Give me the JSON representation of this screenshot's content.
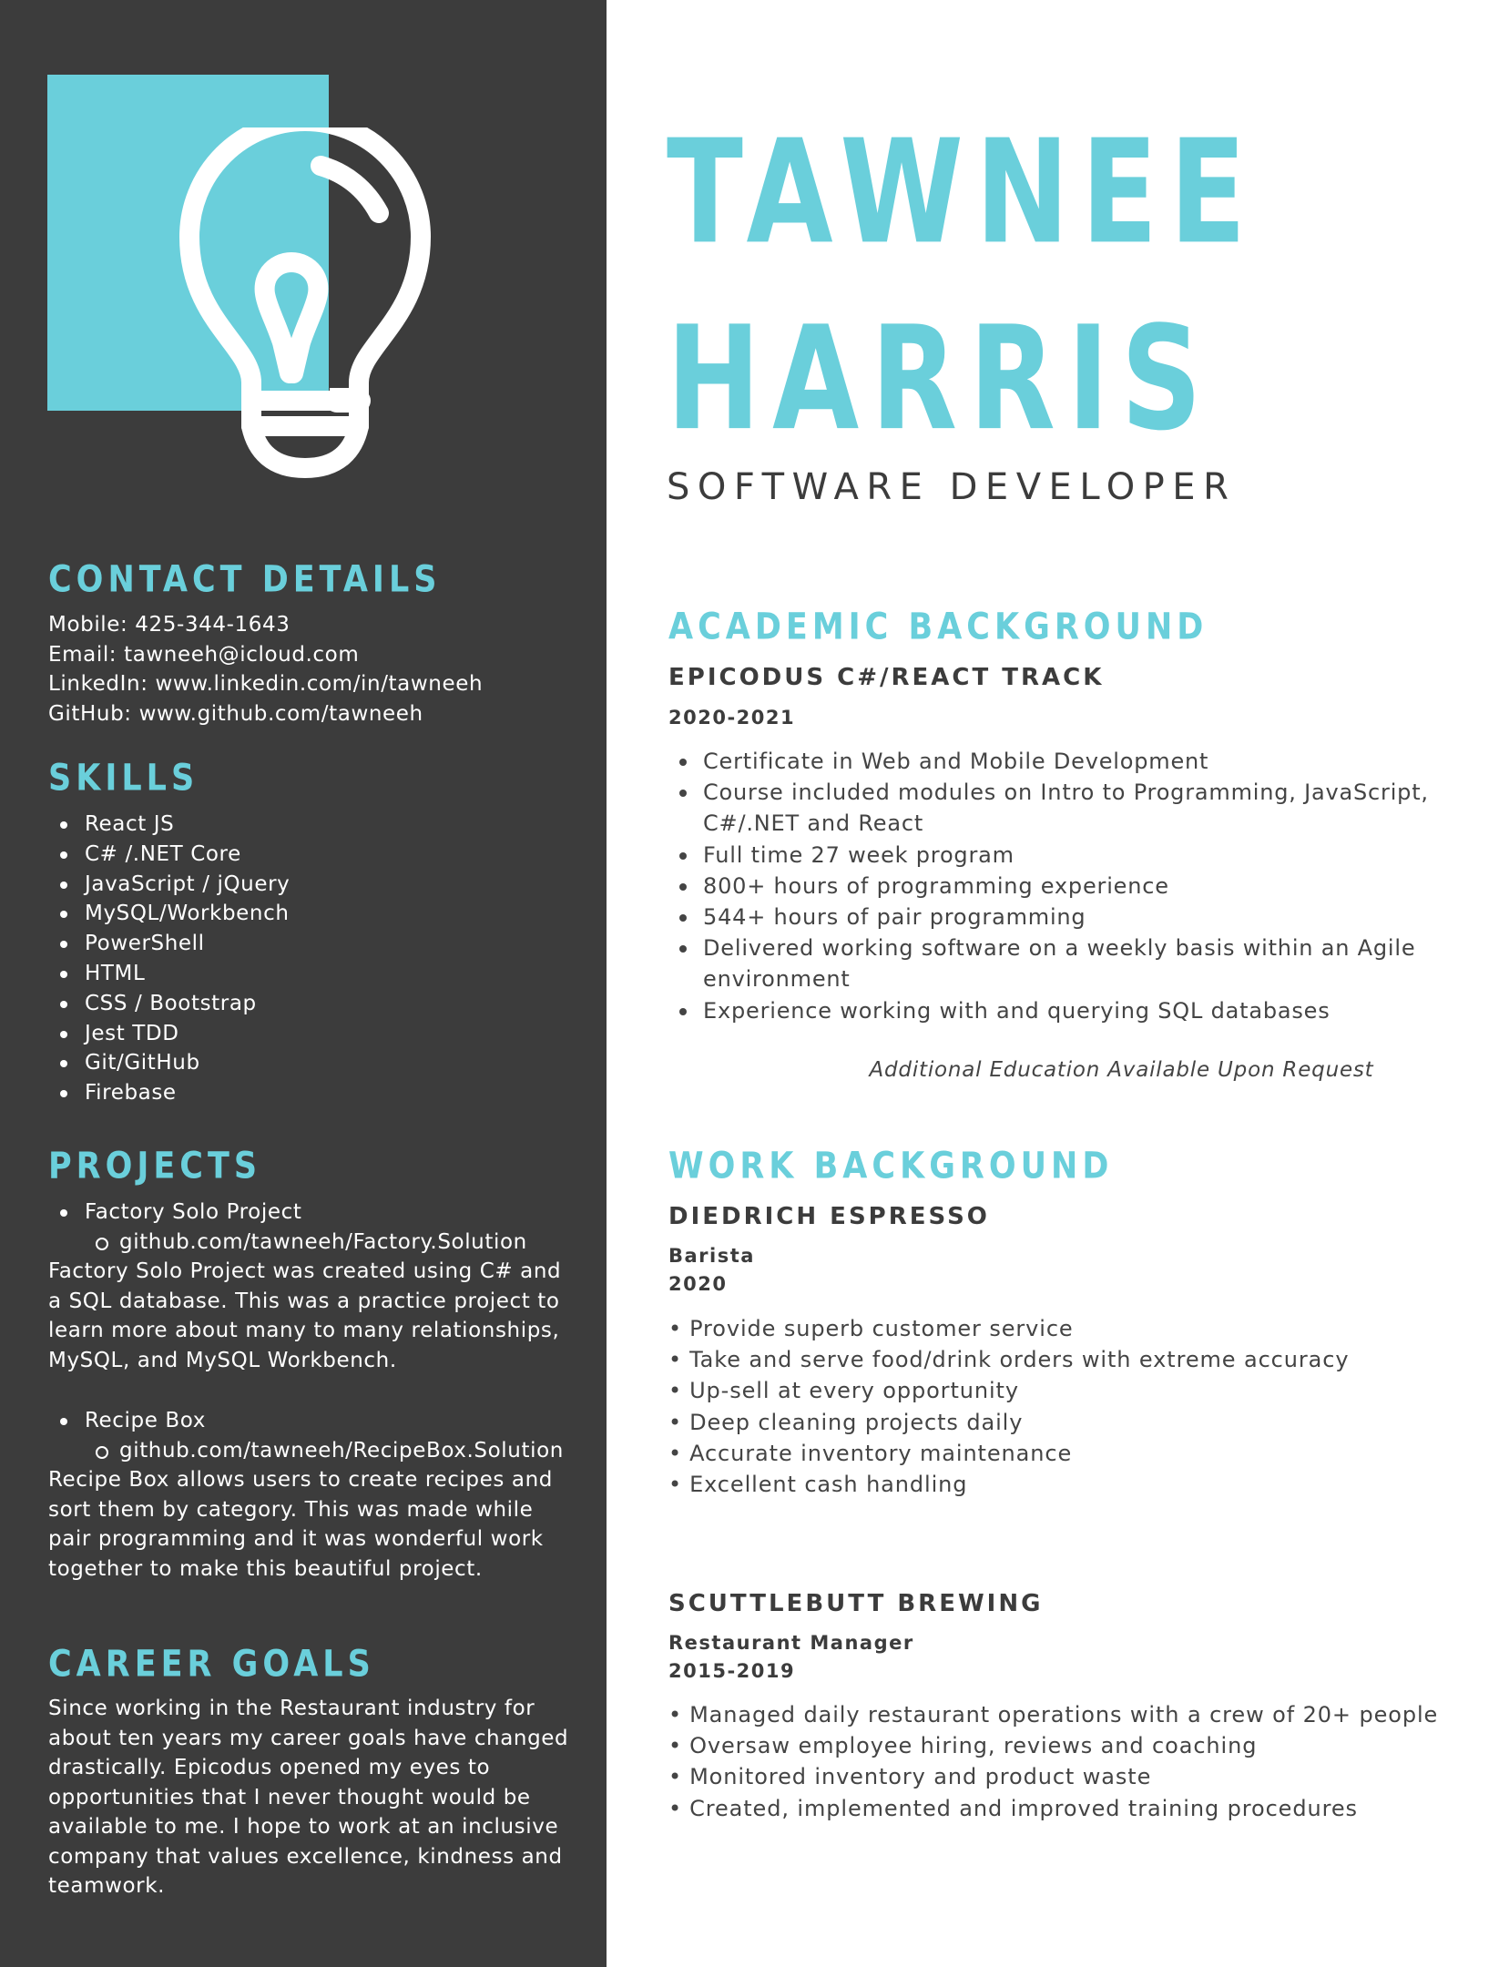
{
  "name": {
    "first": "TAWNEE",
    "last": "HARRIS"
  },
  "title": "SOFTWARE DEVELOPER",
  "colors": {
    "accent": "#6acfdb",
    "sidebar": "#3c3c3c",
    "text": "#444444"
  },
  "logo": {
    "icon": "lightbulb-icon"
  },
  "contact": {
    "heading": "CONTACT DETAILS",
    "lines": [
      "Mobile: 425-344-1643",
      "Email: tawneeh@icloud.com",
      "LinkedIn: www.linkedin.com/in/tawneeh",
      "GitHub: www.github.com/tawneeh"
    ]
  },
  "skills": {
    "heading": "SKILLS",
    "items": [
      "React JS",
      "C# /.NET Core",
      "JavaScript / jQuery",
      "MySQL/Workbench",
      "PowerShell",
      "HTML",
      "CSS / Bootstrap",
      "Jest TDD",
      "Git/GitHub",
      "Firebase"
    ]
  },
  "projects": {
    "heading": "PROJECTS",
    "items": [
      {
        "title": "Factory Solo Project",
        "link": "github.com/tawneeh/Factory.Solution",
        "desc": [
          "Factory Solo Project was created using C# and",
          "a SQL database. This was a practice project to",
          "learn more about many to many relationships,",
          "MySQL, and MySQL Workbench."
        ]
      },
      {
        "title": "Recipe Box",
        "link": "github.com/tawneeh/RecipeBox.Solution",
        "desc": [
          "Recipe Box allows users to create recipes and",
          "sort them by category. This was made while",
          "pair programming and it was wonderful work",
          "together to make this beautiful project."
        ]
      }
    ]
  },
  "career": {
    "heading": "CAREER GOALS",
    "lines": [
      "Since working in the Restaurant industry for",
      "about ten years my career goals have changed",
      "drastically. Epicodus opened my eyes to",
      "opportunities that I never thought would be",
      "available to me. I hope to work at an inclusive",
      "company that values excellence, kindness and",
      "teamwork."
    ]
  },
  "academic": {
    "heading": "ACADEMIC BACKGROUND",
    "school": "EPICODUS C#/REACT TRACK",
    "years": "2020-2021",
    "bullets": [
      [
        "Certificate in Web and Mobile Development"
      ],
      [
        "Course included modules on Intro to Programming, JavaScript,",
        "C#/.NET and React"
      ],
      [
        "Full time 27 week program"
      ],
      [
        "800+ hours of programming experience"
      ],
      [
        "544+ hours of pair programming"
      ],
      [
        "Delivered working software on a weekly basis within an Agile",
        "environment"
      ],
      [
        "Experience working with and querying SQL databases"
      ]
    ],
    "note": "Additional Education Available Upon Request"
  },
  "work": {
    "heading": "WORK BACKGROUND",
    "bullet_char": "•",
    "jobs": [
      {
        "company": "DIEDRICH ESPRESSO",
        "role": "Barista",
        "years": "2020",
        "bullets": [
          "Provide superb customer service",
          "Take and serve food/drink orders with extreme accuracy",
          "Up-sell at every opportunity",
          "Deep cleaning projects daily",
          "Accurate inventory maintenance",
          "Excellent cash handling"
        ]
      },
      {
        "company": "SCUTTLEBUTT BREWING",
        "role": "Restaurant Manager",
        "years": "2015-2019",
        "bullets": [
          "Managed daily restaurant operations with a crew of 20+ people",
          "Oversaw employee hiring, reviews and coaching",
          "Monitored inventory and product waste",
          "Created, implemented and improved training procedures"
        ]
      }
    ]
  }
}
